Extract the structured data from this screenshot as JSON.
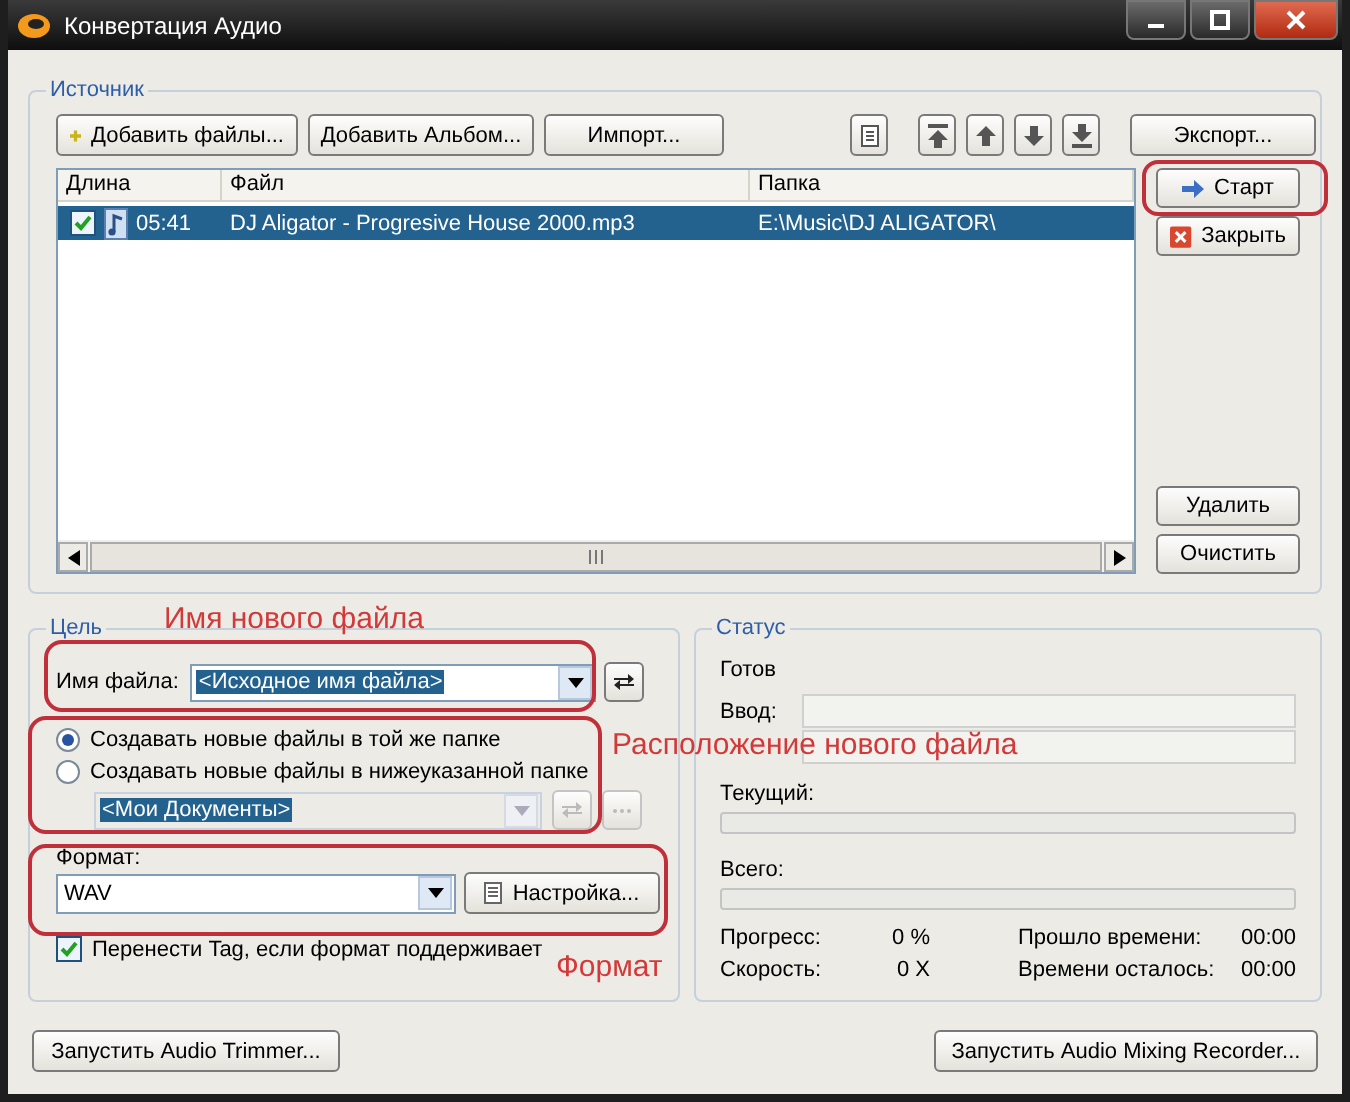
{
  "window": {
    "title": "Конвертация Аудио"
  },
  "source": {
    "title": "Источник",
    "toolbar": [
      {
        "label": "Добавить файлы...",
        "kind": "add"
      },
      {
        "label": "Добавить Альбом...",
        "kind": "plain"
      },
      {
        "label": "Импорт...",
        "kind": "plain"
      }
    ],
    "export": "Экспорт...",
    "table": {
      "columns": [
        "Длина",
        "Файл",
        "Папка"
      ],
      "rows": [
        {
          "selected": true,
          "checked": true,
          "length": "05:41",
          "file": "DJ Aligator - Progresive House 2000.mp3",
          "folder": "E:\\Music\\DJ ALIGATOR\\"
        }
      ]
    },
    "side_buttons": [
      {
        "label": "Старт",
        "kind": "start"
      },
      {
        "label": "Закрыть",
        "kind": "close"
      },
      {
        "label": "Удалить",
        "kind": "plain"
      },
      {
        "label": "Очистить",
        "kind": "plain"
      }
    ]
  },
  "target": {
    "title": "Цель",
    "filename_label": "Имя файла:",
    "filename_value": "<Исходное имя файла>",
    "location_options": [
      {
        "label": "Создавать новые файлы в той же папке",
        "selected": true
      },
      {
        "label": "Создавать новые файлы в нижеуказанной папке",
        "selected": false
      }
    ],
    "folder_value": "<Мои Документы>",
    "folder_disabled": true,
    "format_label": "Формат:",
    "format_value": "WAV",
    "settings_button": "Настройка...",
    "transfer_tag": {
      "label": "Перенести Tag, если формат поддерживает",
      "checked": true
    }
  },
  "status": {
    "title": "Статус",
    "state": "Готов",
    "input_label": "Ввод:",
    "current": {
      "label": "Текущий:",
      "level": 0
    },
    "total": {
      "label": "Всего:",
      "level": 0
    },
    "stats": [
      {
        "label": "Прогресс:",
        "value": "0 %",
        "time_label": "Прошло времени:",
        "time_value": "00:00"
      },
      {
        "label": "Скорость:",
        "value": "0 X",
        "time_label": "Времени осталось:",
        "time_value": "00:00"
      }
    ]
  },
  "bottom_buttons": [
    "Запустить Audio Trimmer...",
    "Запустить Audio Mixing Recorder..."
  ],
  "annotations": [
    {
      "kind": "filename",
      "text": "Имя нового файла"
    },
    {
      "kind": "location",
      "text": "Расположение нового файла"
    },
    {
      "kind": "format",
      "text": "Формат"
    }
  ]
}
